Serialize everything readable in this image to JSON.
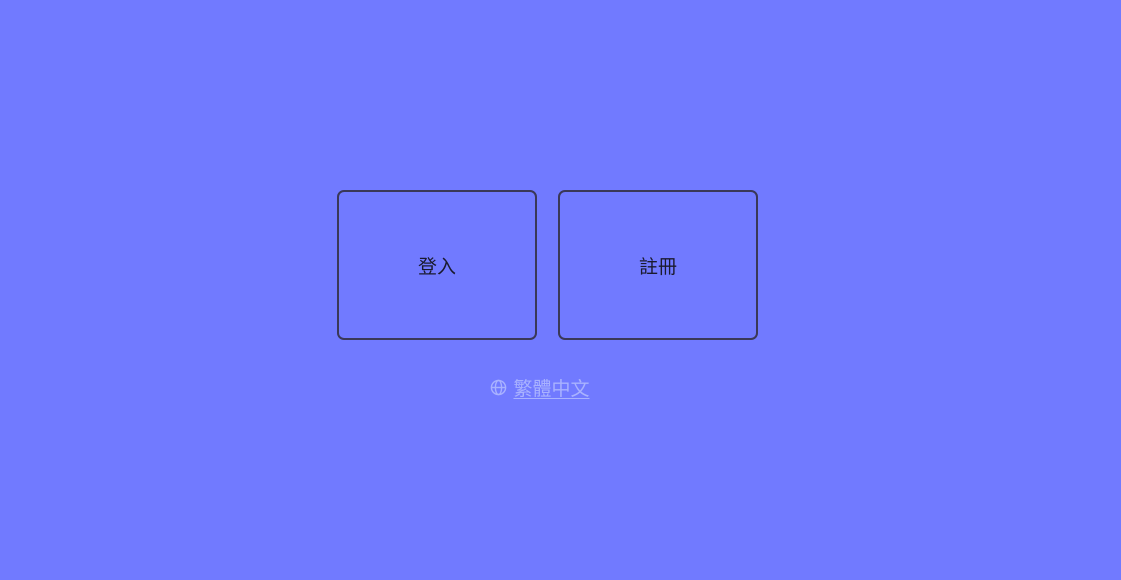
{
  "auth": {
    "login_label": "登入",
    "register_label": "註冊"
  },
  "language": {
    "icon": "globe-icon",
    "label": "繁體中文"
  },
  "colors": {
    "background": "#717aff",
    "card_border": "#3a3858",
    "link": "#a9b2ff"
  }
}
